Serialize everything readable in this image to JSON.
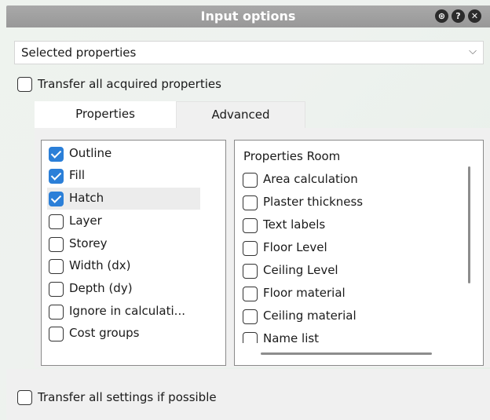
{
  "window": {
    "title": "Input options",
    "title_icons": [
      "pin-icon",
      "help-icon",
      "close-icon"
    ]
  },
  "selection": {
    "value": "Selected properties",
    "arrow": "⌵"
  },
  "transfer_all_acquired": {
    "label": "Transfer all acquired properties",
    "checked": false
  },
  "tabs": [
    {
      "label": "Properties",
      "active": true
    },
    {
      "label": "Advanced",
      "active": false
    }
  ],
  "properties_list": [
    {
      "label": "Outline",
      "checked": true
    },
    {
      "label": "Fill",
      "checked": true
    },
    {
      "label": "Hatch",
      "checked": true,
      "selected": true
    },
    {
      "label": "Layer",
      "checked": false
    },
    {
      "label": "Storey",
      "checked": false
    },
    {
      "label": "Width (dx)",
      "checked": false
    },
    {
      "label": "Depth (dy)",
      "checked": false
    },
    {
      "label": "Ignore in calculati...",
      "checked": false
    },
    {
      "label": "Cost groups",
      "checked": false
    }
  ],
  "room_properties": {
    "header": "Properties Room",
    "items": [
      {
        "label": "Area calculation",
        "checked": false
      },
      {
        "label": "Plaster thickness",
        "checked": false
      },
      {
        "label": "Text labels",
        "checked": false
      },
      {
        "label": "Floor Level",
        "checked": false
      },
      {
        "label": "Ceiling Level",
        "checked": false
      },
      {
        "label": "Floor material",
        "checked": false
      },
      {
        "label": "Ceiling material",
        "checked": false
      },
      {
        "label": "Name list",
        "checked": false
      }
    ]
  },
  "transfer_all_settings": {
    "label": "Transfer all settings if possible",
    "checked": false
  },
  "colors": {
    "titlebar": "#a0a0a0",
    "checkbox_checked": "#2b7fd8"
  }
}
